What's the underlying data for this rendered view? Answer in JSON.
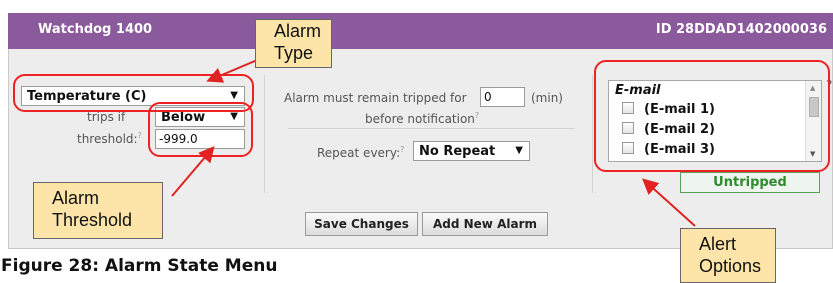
{
  "header": {
    "title": "Watchdog 1400",
    "id_text": "ID 28DDAD1402000036",
    "color": "#8a5a9c"
  },
  "left": {
    "type_select": "Temperature (C)",
    "trips_if_label": "trips if",
    "trips_if_select": "Below",
    "threshold_label": "threshold:",
    "threshold_value": "-999.0",
    "help_mark": "?"
  },
  "middle": {
    "tripped_text_before": "Alarm must remain tripped for",
    "tripped_value": "0",
    "tripped_unit": "(min)",
    "tripped_text_after": "before notification",
    "repeat_label": "Repeat every:",
    "repeat_select": "No Repeat"
  },
  "right": {
    "email_heading": "E-mail",
    "emails": [
      "(E-mail 1)",
      "(E-mail 2)",
      "(E-mail 3)"
    ],
    "status": "Untripped",
    "status_color": "#2e8b2e"
  },
  "buttons": {
    "save": "Save Changes",
    "add": "Add New Alarm"
  },
  "callouts": {
    "alarm_type": [
      "Alarm",
      "Type"
    ],
    "alarm_threshold": [
      "Alarm",
      "Threshold"
    ],
    "alert_options": [
      "Alert",
      "Options"
    ],
    "highlight_color": "#e22222"
  },
  "caption": "Figure 28: Alarm State Menu",
  "icons": {
    "dropdown": "▼",
    "scroll_up": "▲",
    "scroll_down": "▼"
  }
}
